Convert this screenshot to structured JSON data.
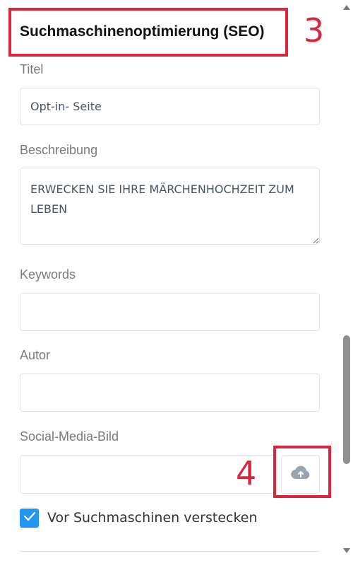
{
  "section": {
    "title": "Suchmaschinenoptimierung (SEO)"
  },
  "annotations": {
    "title_number": "3",
    "upload_number": "4"
  },
  "fields": {
    "title": {
      "label": "Titel",
      "value": "Opt-in- Seite"
    },
    "description": {
      "label": "Beschreibung",
      "value": "ERWECKEN SIE IHRE MÄRCHENHOCHZEIT ZUM LEBEN"
    },
    "keywords": {
      "label": "Keywords",
      "value": ""
    },
    "author": {
      "label": "Autor",
      "value": ""
    },
    "social_image": {
      "label": "Social-Media-Bild",
      "value": ""
    }
  },
  "upload_icon": "cloud-upload-icon",
  "hide_checkbox": {
    "label": "Vor Suchmaschinen verstecken",
    "checked": true
  },
  "colors": {
    "accent": "#2196f3",
    "annotation": "#d7263d"
  }
}
